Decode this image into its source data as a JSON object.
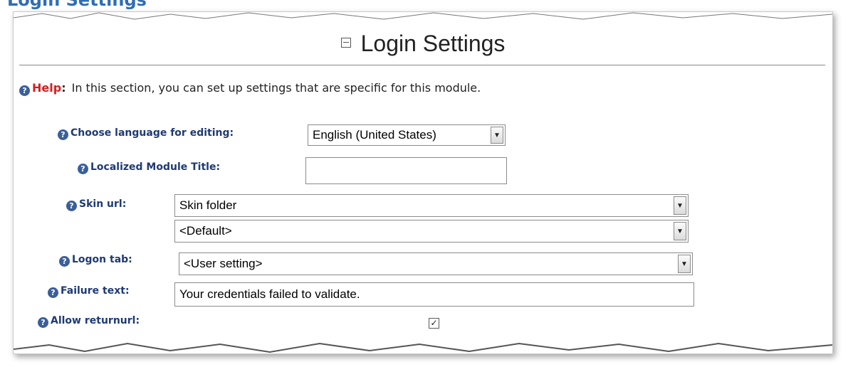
{
  "page_heading": "Login Settings",
  "section": {
    "title": "Login Settings",
    "help_label": "Help",
    "help_separator": ":",
    "help_text": "In this section, you can set up settings that are specific for this module."
  },
  "fields": {
    "language": {
      "label": "Choose language for editing:",
      "value": "English (United States)"
    },
    "module_title": {
      "label": "Localized Module Title:",
      "value": ""
    },
    "skin_url": {
      "label": "Skin url:",
      "folder_value": "Skin folder",
      "skin_value": "<Default>"
    },
    "logon_tab": {
      "label": "Logon tab:",
      "value": "<User setting>"
    },
    "failure_text": {
      "label": "Failure text:",
      "value": "Your credentials failed to validate."
    },
    "allow_returnurl": {
      "label": "Allow returnurl:",
      "checked": true
    }
  },
  "icons": {
    "help": "help-question-icon",
    "collapse": "collapse-minus-icon",
    "dropdown": "chevron-down-icon",
    "check": "checkmark-icon"
  },
  "colors": {
    "label": "#1f3a73",
    "help_word": "#d42020",
    "help_icon": "#3a5f9a"
  }
}
